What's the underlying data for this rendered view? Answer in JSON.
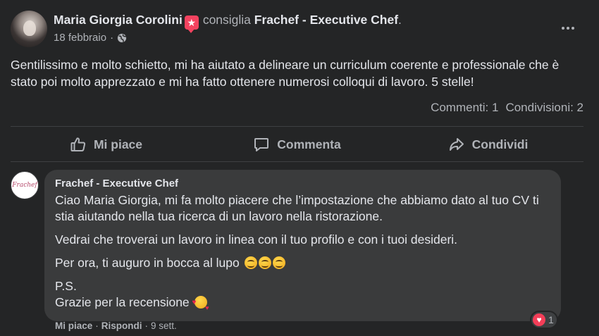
{
  "post": {
    "author": "Maria Giorgia Corolini",
    "recommends_text": "consiglia",
    "page_name": "Frachef - Executive Chef",
    "page_name_suffix": ".",
    "date": "18 febbraio",
    "dot": "·",
    "text": "Gentilissimo e molto schietto, mi ha aiutato a delineare un curriculum coerente e professionale che è stato poi molto apprezzato e mi ha fatto ottenere numerosi colloqui di lavoro. 5 stelle!",
    "comments_count": "Commenti: 1",
    "shares_count": "Condivisioni: 2"
  },
  "actions": {
    "like": "Mi piace",
    "comment": "Commenta",
    "share": "Condividi"
  },
  "comment": {
    "author": "Frachef - Executive Chef",
    "avatar_text": "Frachef",
    "paragraph1": "Ciao Maria Giorgia, mi fa molto piacere che l’impostazione che abbiamo dato al tuo CV ti stia aiutando nella tua ricerca di un lavoro nella ristorazione.",
    "paragraph2": "Vedrai che troverai un lavoro in linea con il tuo profilo e con i tuoi desideri.",
    "paragraph3": "Per ora, ti auguro in bocca al lupo",
    "ps_label": "P.S.",
    "ps_text": "Grazie per la recensione",
    "like_action": "Mi piace",
    "reply_action": "Rispondi",
    "sep": "·",
    "time": "9 sett.",
    "reaction_count": "1"
  },
  "icons": {
    "badge": "star-badge-icon",
    "globe": "globe-icon",
    "more": "more-icon",
    "like": "thumbs-up-icon",
    "comment": "comment-icon",
    "share": "share-icon",
    "reaction": "heart-icon"
  },
  "colors": {
    "background": "#242526",
    "bubble": "#3a3b3c",
    "text": "#e4e6eb",
    "secondary_text": "#b0b3b8",
    "badge": "#f3425f",
    "heart": "#f33e58"
  }
}
